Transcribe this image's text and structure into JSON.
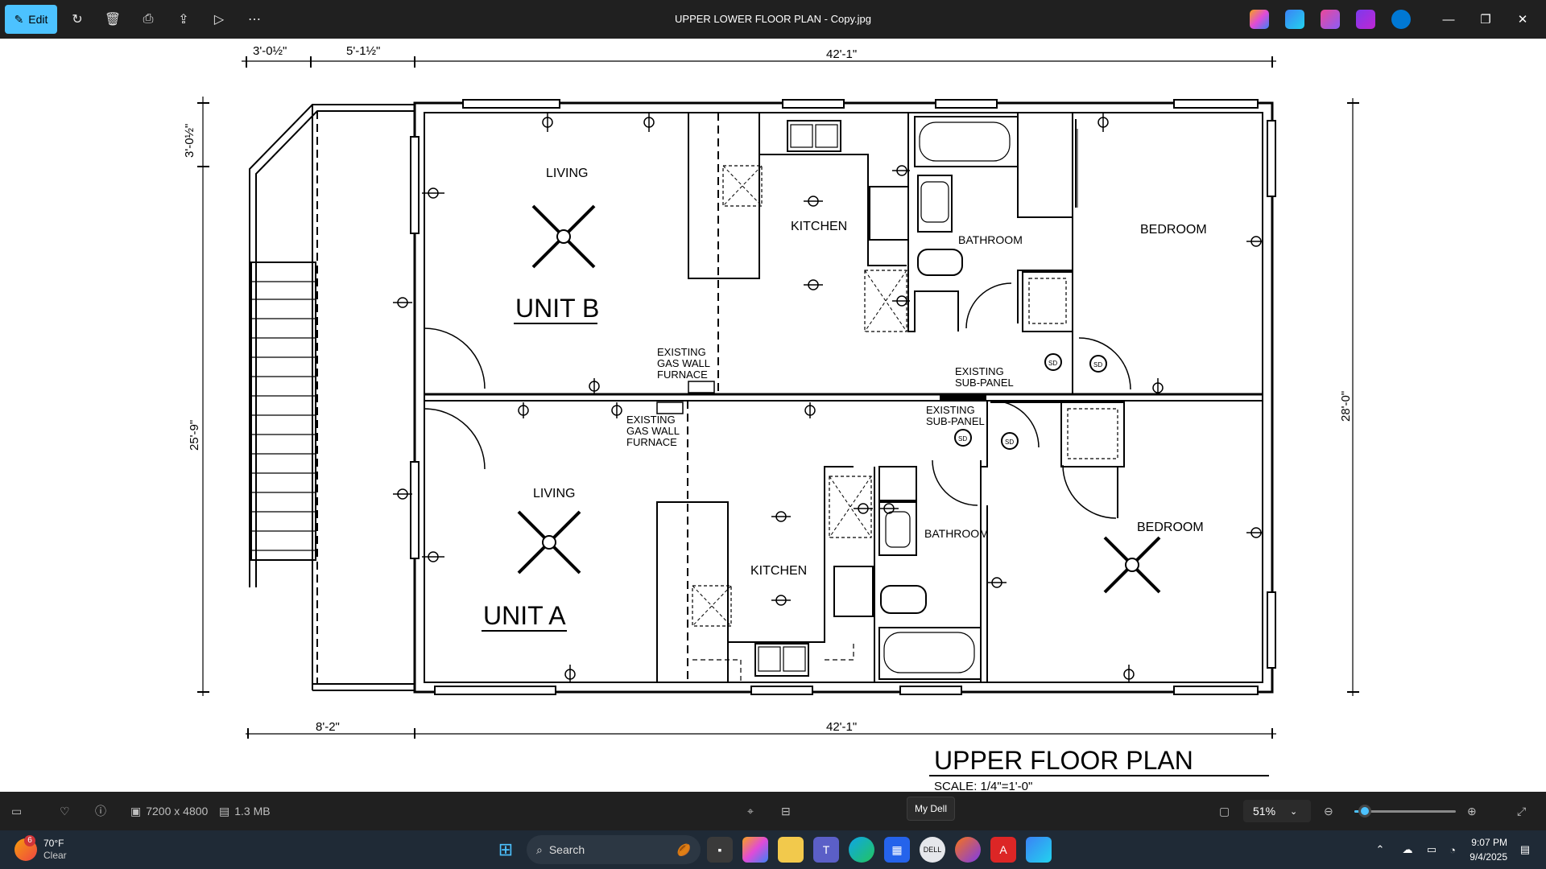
{
  "titlebar": {
    "edit_label": "Edit",
    "title": "UPPER LOWER FLOOR PLAN  - Copy.jpg",
    "icons": [
      "rotate-icon",
      "delete-icon",
      "print-icon",
      "share-icon",
      "slideshow-icon",
      "more-icon"
    ]
  },
  "plan": {
    "dims": {
      "top_left_a": "3'-0½\"",
      "top_left_b": "5'-1½\"",
      "top_main": "42'-1\"",
      "bottom_left": "8'-2\"",
      "bottom_main": "42'-1\"",
      "left_top": "3'-0½\"",
      "left_main": "25'-9\"",
      "right_main": "28'-0\""
    },
    "rooms": {
      "living_b": "LIVING",
      "kitchen_b": "KITCHEN",
      "bathroom_b": "BATHROOM",
      "bedroom_b": "BEDROOM",
      "unit_b": "UNIT B",
      "living_a": "LIVING",
      "kitchen_a": "KITCHEN",
      "bathroom_a": "BATHROOM",
      "bedroom_a": "BEDROOM",
      "unit_a": "UNIT A"
    },
    "notes": {
      "furnace_b": [
        "EXISTING",
        "GAS WALL",
        "FURNACE"
      ],
      "furnace_a": [
        "EXISTING",
        "GAS WALL",
        "FURNACE"
      ],
      "subpanel_b": [
        "EXISTING",
        "SUB-PANEL"
      ],
      "subpanel_a": [
        "EXISTING",
        "SUB-PANEL"
      ],
      "smoke": "SD"
    },
    "sheet_title": "UPPER FLOOR PLAN",
    "scale": "SCALE: 1/4\"=1'-0\""
  },
  "statusbar": {
    "dimensions": "7200 x 4800",
    "file_size": "1.3 MB",
    "tooltip": "My Dell",
    "zoom": "51%",
    "zoom_fraction": 0.1
  },
  "taskbar": {
    "weather_temp": "70°F",
    "weather_desc": "Clear",
    "weather_badge": "6",
    "search_placeholder": "Search",
    "time": "9:07 PM",
    "date": "9/4/2025"
  }
}
